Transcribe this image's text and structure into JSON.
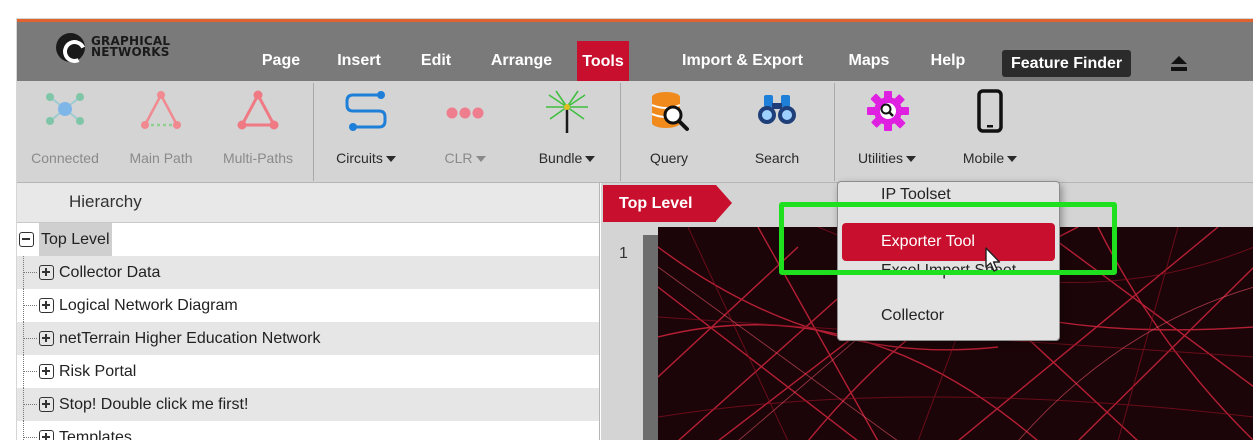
{
  "logo": {
    "line1": "GRAPHICAL",
    "line2": "NETWORKS"
  },
  "menu": {
    "items": [
      "Page",
      "Insert",
      "Edit",
      "Arrange",
      "Tools",
      "Import & Export",
      "Maps",
      "Help"
    ],
    "active": "Tools",
    "feature_finder": "Feature Finder",
    "eject_icon": "eject-icon"
  },
  "ribbon": {
    "connected": "Connected",
    "main_path": "Main Path",
    "multi_paths": "Multi-Paths",
    "circuits": "Circuits",
    "clr": "CLR",
    "bundle": "Bundle",
    "query": "Query",
    "search": "Search",
    "utilities": "Utilities",
    "mobile": "Mobile"
  },
  "hierarchy": {
    "header": "Hierarchy",
    "root": "Top Level",
    "children": [
      "Collector Data",
      "Logical Network Diagram",
      "netTerrain Higher Education Network",
      "Risk Portal",
      "Stop! Double click me first!",
      "Templates"
    ]
  },
  "canvas": {
    "breadcrumb": "Top Level",
    "page_number": "1"
  },
  "utilities_menu": {
    "items": [
      "IP Toolset",
      "Exporter Tool",
      "Excel Import Sheet",
      "Collector"
    ],
    "highlighted": "Exporter Tool"
  },
  "colors": {
    "accent": "#c8102e",
    "menubar": "#7a7a7a",
    "ribbon": "#d4d4d4",
    "highlight": "#1ee01e",
    "magenta_icon": "#e020e0",
    "blue_icon": "#1e7fd8",
    "orange_icon": "#f08a1c"
  }
}
